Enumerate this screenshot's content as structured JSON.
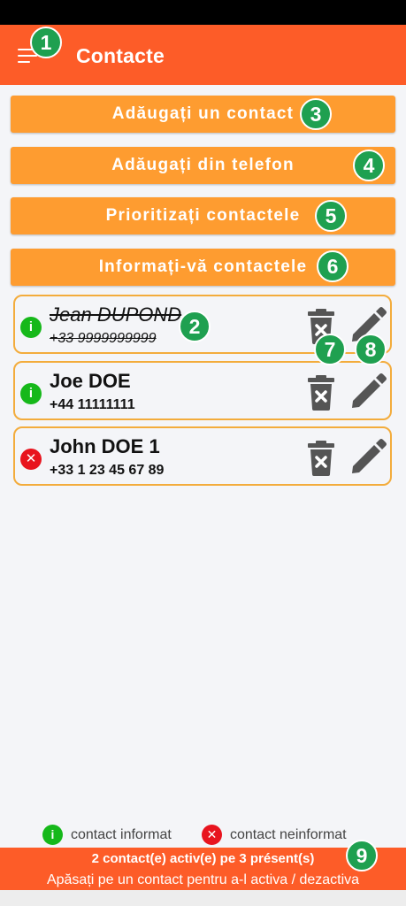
{
  "app_bar": {
    "title": "Contacte",
    "color": "#fd5c28"
  },
  "actions": {
    "add_contact": "Adăugați un contact",
    "add_from_phone": "Adăugați din telefon",
    "prioritize": "Prioritizați contactele",
    "inform": "Informați-vă contactele",
    "color": "#fe9c30"
  },
  "contacts": [
    {
      "name": "Jean DUPOND",
      "phone": "+33 9999999999",
      "status": "informat",
      "active": false
    },
    {
      "name": "Joe DOE",
      "phone": "+44 11111111",
      "status": "informat",
      "active": true
    },
    {
      "name": "John DOE 1",
      "phone": "+33 1 23 45 67 89",
      "status": "neinformat",
      "active": true
    }
  ],
  "icons": {
    "menu": "menu-icon",
    "delete": "delete-icon",
    "edit": "edit-icon",
    "info": "info-icon",
    "close": "close-icon"
  },
  "badges": [
    "1",
    "2",
    "3",
    "4",
    "5",
    "6",
    "7",
    "8",
    "9"
  ],
  "legend": {
    "informed": "contact informat",
    "not_informed": "contact neinformat"
  },
  "footer": {
    "count": "2 contact(e) activ(e) pe 3 présent(s)",
    "hint": "Apăsați pe un contact pentru a-l activa / dezactiva"
  },
  "colors": {
    "informed": "#16b81a",
    "not_informed": "#e8141e",
    "card_border": "#f3ac3c",
    "badge": "#1fa050"
  }
}
